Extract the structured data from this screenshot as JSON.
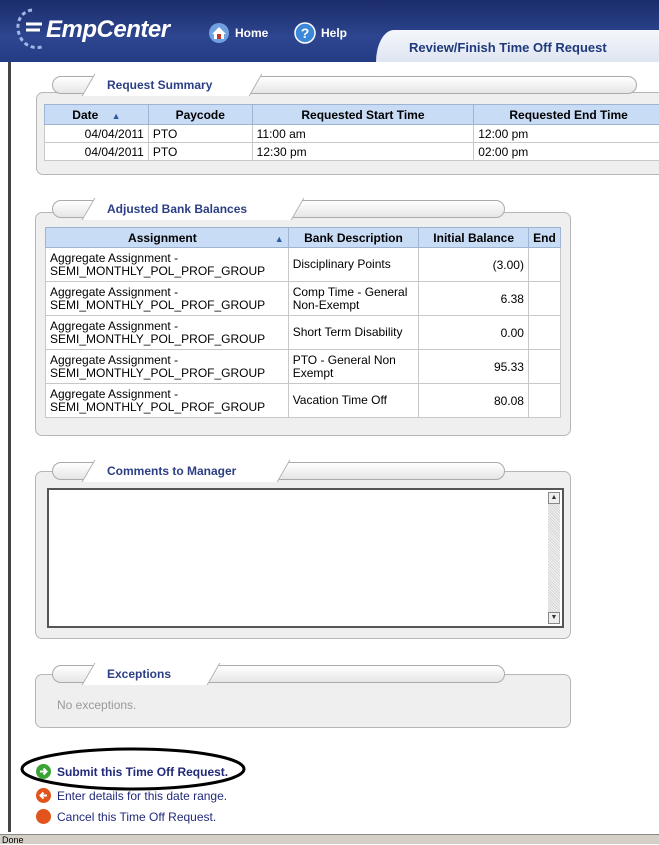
{
  "header": {
    "logo": "EmpCenter",
    "nav": [
      {
        "label": "Home",
        "icon": "home-icon"
      },
      {
        "label": "Help",
        "icon": "help-icon"
      }
    ],
    "page_title": "Review/Finish Time Off Request"
  },
  "request_summary": {
    "title": "Request Summary",
    "columns": [
      "Date",
      "Paycode",
      "Requested Start Time",
      "Requested End Time"
    ],
    "rows": [
      [
        "04/04/2011",
        "PTO",
        "11:00 am",
        "12:00 pm"
      ],
      [
        "04/04/2011",
        "PTO",
        "12:30 pm",
        "02:00 pm"
      ]
    ]
  },
  "bank_balances": {
    "title": "Adjusted Bank Balances",
    "columns": [
      "Assignment",
      "Bank Description",
      "Initial Balance",
      "End"
    ],
    "rows": [
      [
        "Aggregate Assignment - SEMI_MONTHLY_POL_PROF_GROUP",
        "Disciplinary Points",
        "(3.00)",
        ""
      ],
      [
        "Aggregate Assignment - SEMI_MONTHLY_POL_PROF_GROUP",
        "Comp Time - General Non-Exempt",
        "6.38",
        ""
      ],
      [
        "Aggregate Assignment - SEMI_MONTHLY_POL_PROF_GROUP",
        "Short Term Disability",
        "0.00",
        ""
      ],
      [
        "Aggregate Assignment - SEMI_MONTHLY_POL_PROF_GROUP",
        "PTO - General Non Exempt",
        "95.33",
        ""
      ],
      [
        "Aggregate Assignment - SEMI_MONTHLY_POL_PROF_GROUP",
        "Vacation Time Off",
        "80.08",
        ""
      ]
    ]
  },
  "comments": {
    "title": "Comments to Manager",
    "value": ""
  },
  "exceptions": {
    "title": "Exceptions",
    "text": "No exceptions."
  },
  "actions": [
    {
      "label": "Submit this Time Off Request.",
      "icon": "submit-arrow-icon",
      "color": "#3aa535"
    },
    {
      "label": "Enter details for this date range.",
      "icon": "back-arrow-icon",
      "color": "#e2541c"
    },
    {
      "label": "Cancel this Time Off Request.",
      "icon": "cancel-icon",
      "color": "#e2541c"
    }
  ],
  "status_bar": "Done",
  "colors": {
    "header_bg": "#2d468f",
    "table_header": "#c9dcf5",
    "link": "#222a7a"
  }
}
